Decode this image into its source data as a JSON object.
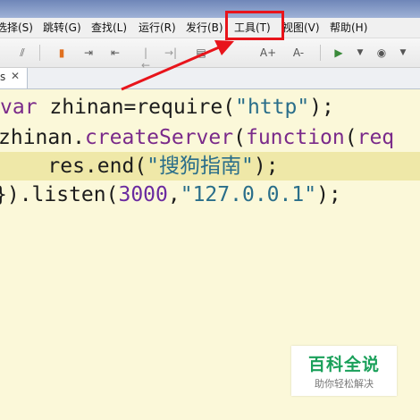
{
  "menubar": {
    "items": [
      {
        "label": "选择(S)"
      },
      {
        "label": "跳转(G)"
      },
      {
        "label": "查找(L)"
      },
      {
        "label": "运行(R)"
      },
      {
        "label": "发行(B)"
      },
      {
        "label": "工具(T)"
      },
      {
        "label": "视图(V)"
      },
      {
        "label": "帮助(H)"
      }
    ]
  },
  "toolbar": {
    "font_increase_label": "A+",
    "font_decrease_label": "A-"
  },
  "tab": {
    "label": "s",
    "close": "✕"
  },
  "editor": {
    "line1": {
      "kw": "var",
      "rest": " zhinan=require(",
      "str": "\"http\"",
      "end": ");"
    },
    "line2": {
      "obj": "zhinan.",
      "method": "createServer",
      "paren": "(",
      "kw": "function",
      "paren2": "(",
      "arg": "req"
    },
    "line3": {
      "indent": "    res.end(",
      "str": "\"搜狗指南\"",
      "end": ");"
    },
    "line4": {
      "start": "}).listen(",
      "num": "3000",
      "comma": ",",
      "str": "\"127.0.0.1\"",
      "end": ");"
    }
  },
  "watermark": {
    "title": "百科全说",
    "subtitle": "助你轻松解决"
  },
  "colors": {
    "highlight_box": "#e8141b",
    "arrow": "#e8141b",
    "editor_bg": "#fbf8d9",
    "current_line": "#efe8a8"
  }
}
